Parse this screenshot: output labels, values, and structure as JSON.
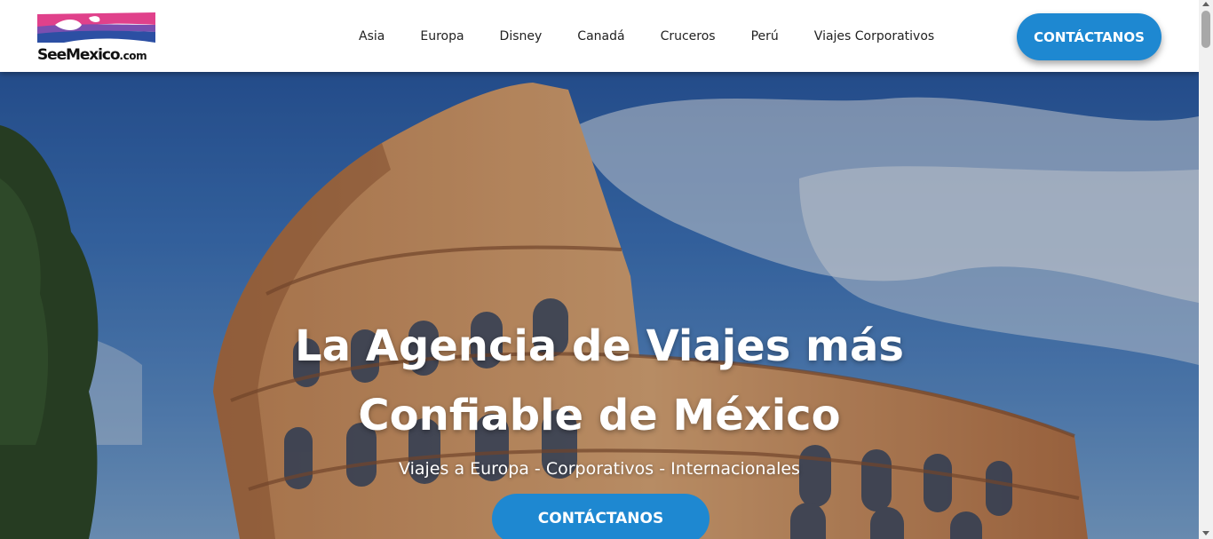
{
  "site": {
    "logo_text": "SeeMexico",
    "logo_suffix": ".com"
  },
  "nav": {
    "items": [
      {
        "label": "Asia"
      },
      {
        "label": "Europa"
      },
      {
        "label": "Disney"
      },
      {
        "label": "Canadá"
      },
      {
        "label": "Cruceros"
      },
      {
        "label": "Perú"
      },
      {
        "label": "Viajes Corporativos"
      }
    ],
    "cta_label": "CONTÁCTANOS"
  },
  "hero": {
    "title_line1": "La Agencia de Viajes más",
    "title_line2": "Confiable de México",
    "subtitle": "Viajes a Europa - Corporativos - Internacionales",
    "cta_label": "CONTÁCTANOS",
    "background": "colosseum-photo"
  },
  "colors": {
    "accent": "#1e88d1",
    "logo_pink": "#e0418b",
    "logo_blue": "#2c4fa3"
  },
  "icons": {
    "scroll_up": "scroll-up-arrow-icon",
    "scroll_down": "scroll-down-arrow-icon"
  }
}
